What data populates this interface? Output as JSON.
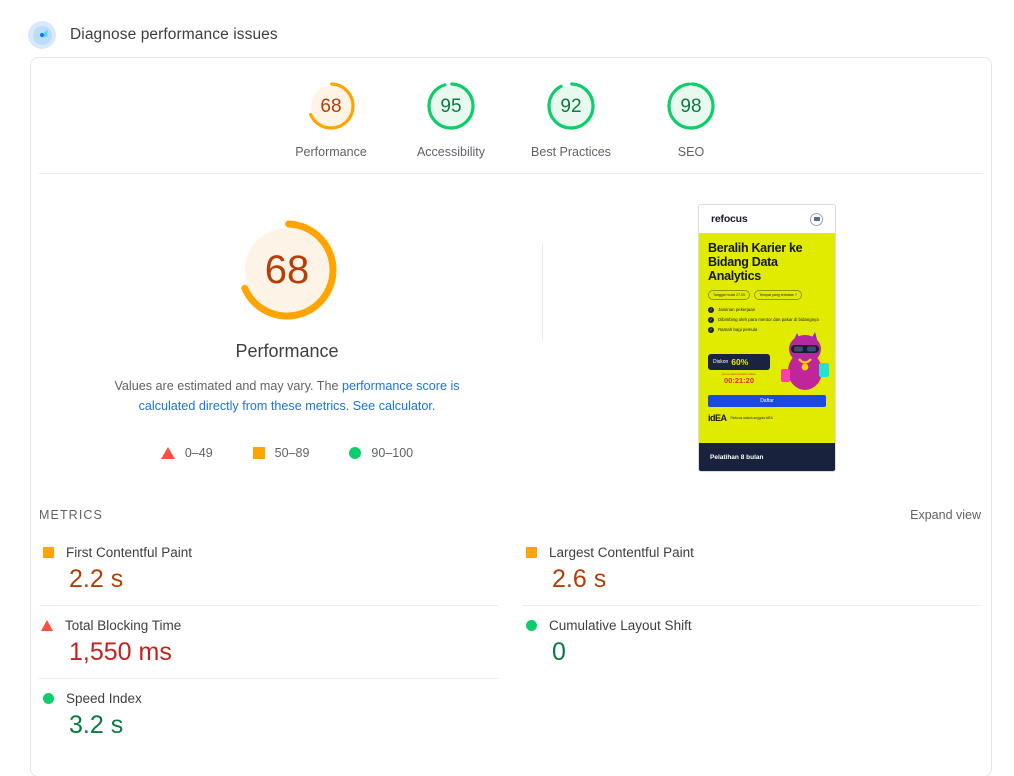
{
  "header": {
    "icon": "speedometer-icon",
    "title": "Diagnose performance issues"
  },
  "category_gauges": [
    {
      "score": "68",
      "label": "Performance",
      "color": "#b53d06",
      "arc": "#ffa400",
      "fill": "#fff4e5",
      "pct": 68
    },
    {
      "score": "95",
      "label": "Accessibility",
      "color": "#0b7a3e",
      "arc": "#0cce6b",
      "fill": "#e8faf0",
      "pct": 95
    },
    {
      "score": "92",
      "label": "Best Practices",
      "color": "#0b7a3e",
      "arc": "#0cce6b",
      "fill": "#e8faf0",
      "pct": 92
    },
    {
      "score": "98",
      "label": "SEO",
      "color": "#0b7a3e",
      "arc": "#0cce6b",
      "fill": "#e8faf0",
      "pct": 98
    }
  ],
  "primary_gauge": {
    "score": "68",
    "label": "Performance",
    "arc_color": "#ffa400",
    "fill_color": "#fdf3e6",
    "score_color": "#b53d06",
    "pct": 68
  },
  "description": {
    "part1": "Values are estimated and may vary. The ",
    "link1": "performance score is calculated directly from these metrics.",
    "part2": " ",
    "link2": "See calculator.",
    "link_color": "#1a73e8"
  },
  "legend": [
    {
      "icon": "triangle-icon",
      "shape": "triangle",
      "range": "0–49",
      "color": "#ff4e42"
    },
    {
      "icon": "square-icon",
      "shape": "square",
      "range": "50–89",
      "color": "#ffa400"
    },
    {
      "icon": "circle-icon",
      "shape": "circle",
      "range": "90–100",
      "color": "#0cce6b"
    }
  ],
  "screenshot_preview": {
    "logo": "refocus",
    "headline": "Beralih Karier ke Bidang Data Analytics",
    "pills": [
      "Tanggal mulai 27.05",
      "Tempat yang terbatas ?"
    ],
    "bullets": [
      "Jaminan pekerjaan",
      "Dibimbing oleh para mentor dan pakar di bidangnya",
      "Ramah bagi pemula"
    ],
    "promo_label": "Diskon",
    "promo_percent": "60%",
    "promo_sub": "promo akan berakhir dalam",
    "promo_timer": "00:21:20",
    "cta": "Daftar",
    "partner_mark": "idEA",
    "partner_text": "Refocus adalah anggota idEA",
    "footer": "Pelatihan 8 bulan"
  },
  "metrics_section": {
    "title": "METRICS",
    "expand_label": "Expand view",
    "left_column": [
      {
        "icon": "square-icon",
        "shape": "square",
        "name": "First Contentful Paint",
        "value": "2.2 s",
        "icon_color": "#ffa400",
        "value_color": "#b53d06"
      },
      {
        "icon": "triangle-icon",
        "shape": "triangle",
        "name": "Total Blocking Time",
        "value": "1,550 ms",
        "icon_color": "#ff4e42",
        "value_color": "#c5221f"
      },
      {
        "icon": "circle-icon",
        "shape": "circle",
        "name": "Speed Index",
        "value": "3.2 s",
        "icon_color": "#0cce6b",
        "value_color": "#0b7a3e"
      }
    ],
    "right_column": [
      {
        "icon": "square-icon",
        "shape": "square",
        "name": "Largest Contentful Paint",
        "value": "2.6 s",
        "icon_color": "#ffa400",
        "value_color": "#b53d06"
      },
      {
        "icon": "circle-icon",
        "shape": "circle",
        "name": "Cumulative Layout Shift",
        "value": "0",
        "icon_color": "#0cce6b",
        "value_color": "#0b7a3e"
      }
    ]
  }
}
